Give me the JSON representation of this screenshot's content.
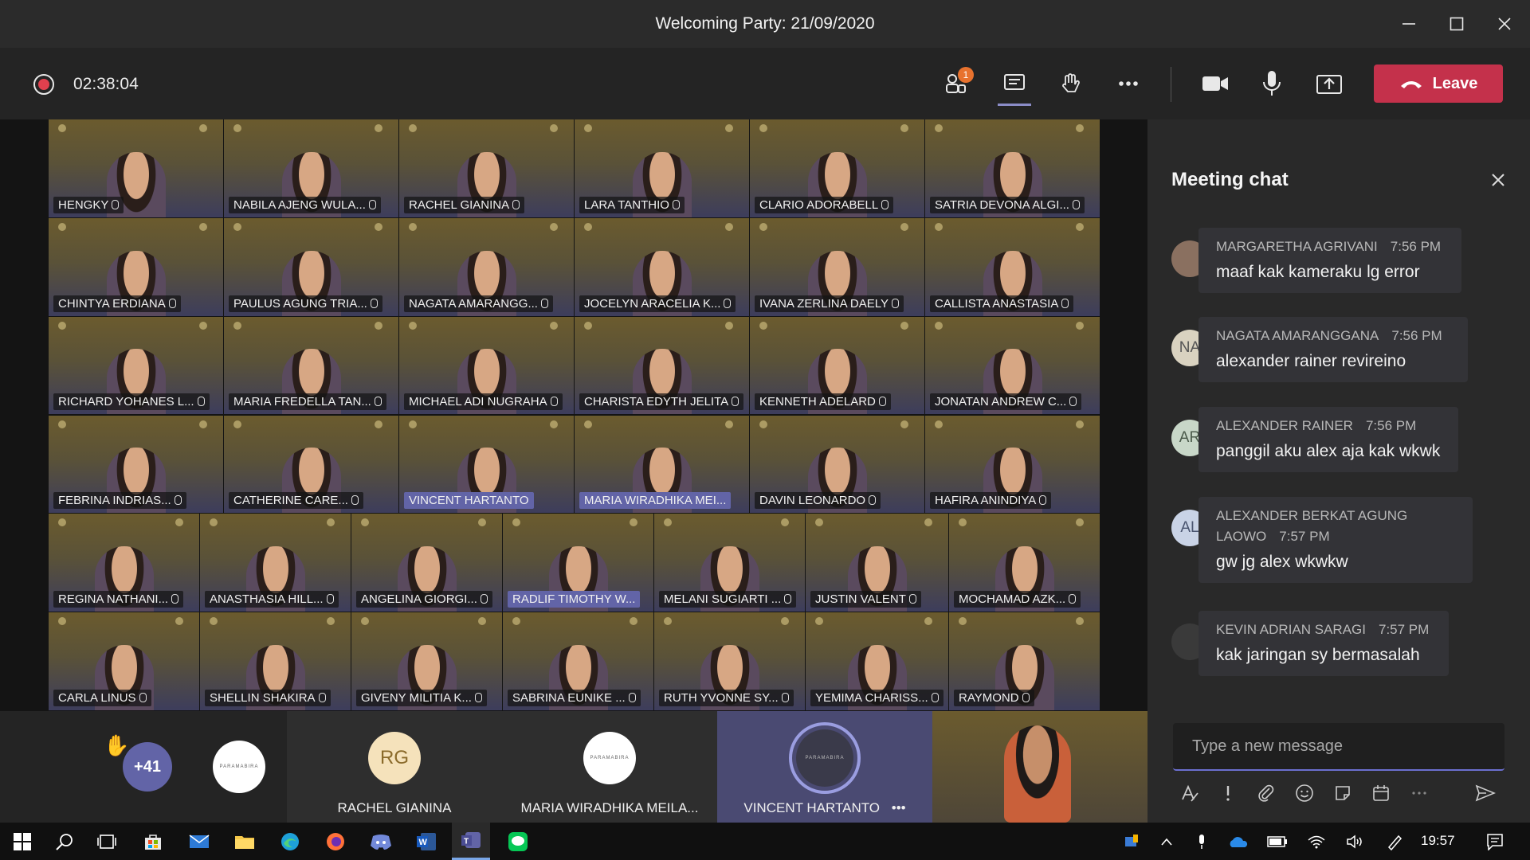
{
  "window": {
    "title": "Welcoming Party: 21/09/2020"
  },
  "toolbar": {
    "timer": "02:38:04",
    "participants_badge": "1",
    "leave_label": "Leave"
  },
  "grid": {
    "rows": [
      [
        "HENGKY",
        "NABILA AJENG WULA...",
        "RACHEL GIANINA",
        "LARA TANTHIO",
        "CLARIO ADORABELL",
        "SATRIA DEVONA ALGI..."
      ],
      [
        "CHINTYA ERDIANA",
        "PAULUS AGUNG TRIA...",
        "NAGATA AMARANGG...",
        "JOCELYN ARACELIA K...",
        "IVANA ZERLINA DAELY",
        "CALLISTA ANASTASIA"
      ],
      [
        "RICHARD YOHANES L...",
        "MARIA FREDELLA TAN...",
        "MICHAEL ADI NUGRAHA",
        "CHARISTA EDYTH JELITA",
        "KENNETH ADELARD",
        "JONATAN ANDREW C..."
      ],
      [
        "FEBRINA INDRIAS...",
        "CATHERINE CARE...",
        "VINCENT HARTANTO",
        "MARIA WIRADHIKA MEI...",
        "DAVIN LEONARDO",
        "HAFIRA ANINDIYA"
      ],
      [
        "REGINA NATHANI...",
        "ANASTHASIA HILL...",
        "ANGELINA GIORGI...",
        "RADLIF TIMOTHY W...",
        "MELANI SUGIARTI ...",
        "JUSTIN VALENT",
        "MOCHAMAD AZK..."
      ],
      [
        "CARLA LINUS",
        "SHELLIN SHAKIRA",
        "GIVENY MILITIA K...",
        "SABRINA EUNIKE ...",
        "RUTH YVONNE SY...",
        "YEMIMA CHARISS...",
        "RAYMOND"
      ]
    ]
  },
  "bottom": {
    "overflow_count": "+41",
    "logo_text": "PARAMABIRA",
    "rachel_initials": "RG",
    "rachel_name": "RACHEL GIANINA",
    "maria_name": "MARIA WIRADHIKA MEILA...",
    "vincent_name": "VINCENT HARTANTO",
    "more_label": "•••"
  },
  "chat": {
    "title": "Meeting chat",
    "messages": [
      {
        "sender": "MARGARETHA AGRIVANI",
        "time": "7:56 PM",
        "text": "maaf kak kameraku lg error",
        "initials": ""
      },
      {
        "sender": "NAGATA AMARANGGANA",
        "time": "7:56 PM",
        "text": "alexander rainer revireino",
        "initials": "NA"
      },
      {
        "sender": "ALEXANDER RAINER",
        "time": "7:56 PM",
        "text": "panggil aku alex aja kak wkwk",
        "initials": "AR"
      },
      {
        "sender_line1": "ALEXANDER BERKAT AGUNG",
        "sender_line2": "LAOWO",
        "time": "7:57 PM",
        "text": "gw jg alex wkwkw",
        "initials": "AL"
      },
      {
        "sender": "KEVIN ADRIAN SARAGI",
        "time": "7:57 PM",
        "text": "kak jaringan sy bermasalah",
        "initials": ""
      }
    ],
    "compose_placeholder": "Type a new message"
  },
  "taskbar": {
    "clock": "19:57"
  }
}
